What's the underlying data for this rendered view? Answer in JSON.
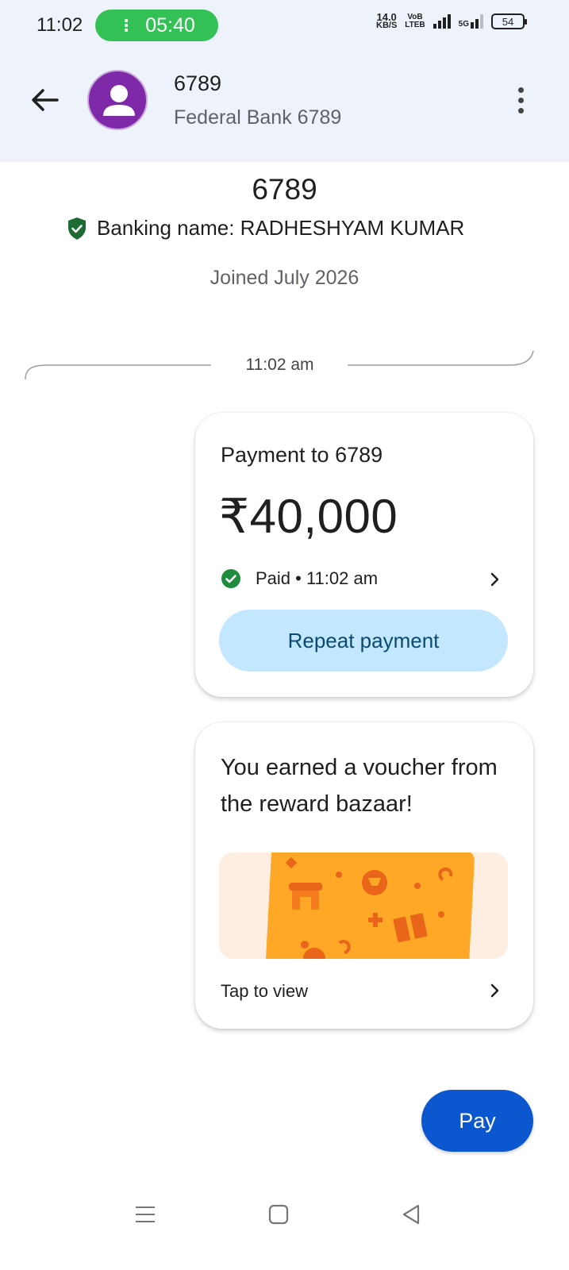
{
  "status_bar": {
    "time": "11:02",
    "call_timer": "05:40",
    "net_speed_value": "14.0",
    "net_speed_unit": "KB/S",
    "volte_top": "VoB",
    "volte_bottom": "LTEB",
    "network": "5G",
    "battery": "54"
  },
  "header": {
    "title": "6789",
    "subtitle": "Federal Bank 6789"
  },
  "profile": {
    "name": "6789",
    "banking_name": "Banking name: RADHESHYAM KUMAR",
    "joined": "Joined July 2026"
  },
  "timeline": {
    "time": "11:02 am"
  },
  "payment_card": {
    "title": "Payment to 6789",
    "amount": "₹40,000",
    "status": "Paid • 11:02 am",
    "repeat_label": "Repeat payment"
  },
  "reward_card": {
    "title": "You earned a voucher from the reward bazaar!",
    "action": "Tap to view"
  },
  "pay_button": {
    "label": "Pay"
  },
  "colors": {
    "header_bg": "#eef3fb",
    "avatar": "#7e2aa8",
    "call_pill": "#33c155",
    "verified_green": "#1e6b34",
    "paid_green": "#1e8e3e",
    "repeat_bg": "#c2e7ff",
    "pay_bg": "#0b57d0",
    "voucher_orange": "#ffa726"
  }
}
